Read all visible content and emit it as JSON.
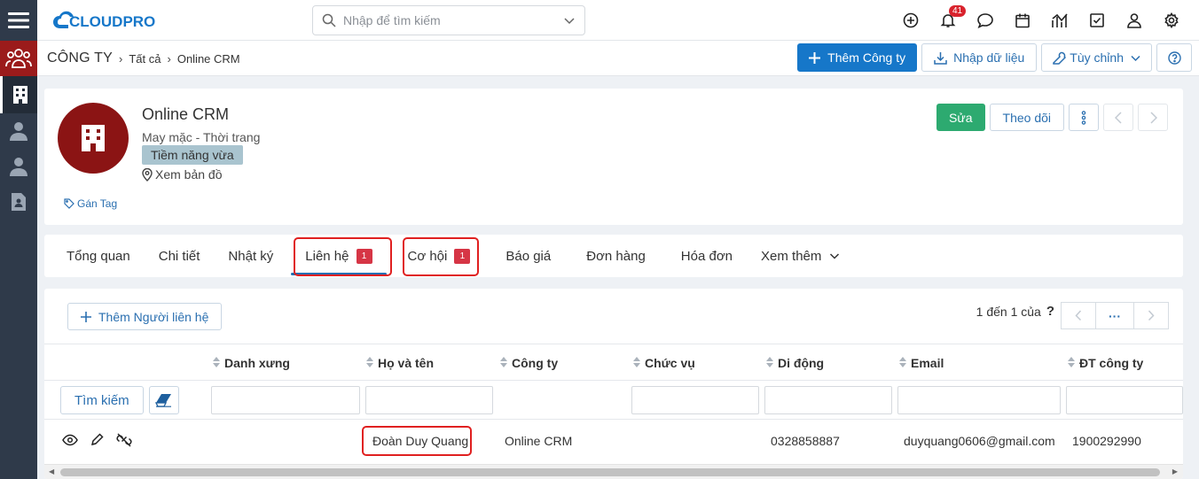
{
  "topbar": {
    "logo_text": "CLOUDPRO",
    "search_placeholder": "Nhập để tìm kiếm",
    "notification_count": "41"
  },
  "breadcrumb": {
    "root": "CÔNG TY",
    "level1": "Tất cả",
    "current": "Online CRM"
  },
  "page_actions": {
    "add_company": "Thêm Công ty",
    "import": "Nhập dữ liệu",
    "customize": "Tùy chỉnh"
  },
  "company": {
    "name": "Online CRM",
    "industry": "May mặc - Thời trang",
    "rating": "Tiềm năng vừa",
    "map_link": "Xem bản đồ",
    "tag_link": "Gán Tag"
  },
  "header_actions": {
    "edit": "Sửa",
    "follow": "Theo dõi"
  },
  "tabs": [
    {
      "label": "Tổng quan",
      "count": ""
    },
    {
      "label": "Chi tiết",
      "count": ""
    },
    {
      "label": "Nhật ký",
      "count": ""
    },
    {
      "label": "Liên hệ",
      "count": "1"
    },
    {
      "label": "Cơ hội",
      "count": "1"
    },
    {
      "label": "Báo giá",
      "count": ""
    },
    {
      "label": "Đơn hàng",
      "count": ""
    },
    {
      "label": "Hóa đơn",
      "count": ""
    },
    {
      "label": "Xem thêm",
      "count": ""
    }
  ],
  "contacts": {
    "add_button": "Thêm Người liên hệ",
    "pager_text": "1 đến 1 của",
    "pager_help": "?",
    "pager_more": "···",
    "search_button": "Tìm kiếm",
    "columns": [
      "Danh xưng",
      "Họ và tên",
      "Công ty",
      "Chức vụ",
      "Di động",
      "Email",
      "ĐT công ty"
    ],
    "rows": [
      {
        "salutation": "",
        "full_name": "Đoàn Duy Quang",
        "company": "Online CRM",
        "title": "",
        "mobile": "0328858887",
        "email": "duyquang0606@gmail.com",
        "office_phone": "1900292990"
      }
    ]
  },
  "colors": {
    "primary": "#1677c9",
    "green": "#2daa70",
    "rail": "#2f3a4a",
    "avatar": "#8b1414",
    "badge": "#d63545",
    "highlight": "#e02020"
  }
}
